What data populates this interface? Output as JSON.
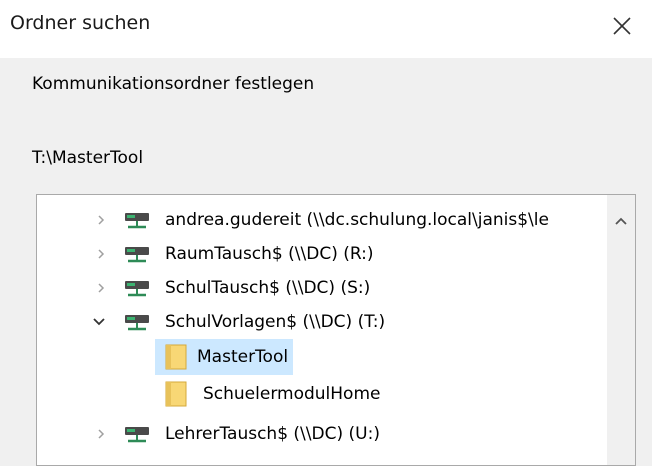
{
  "window": {
    "title": "Ordner suchen",
    "close_icon": "close-icon"
  },
  "description": "Kommunikationsordner festlegen",
  "current_path": "T:\\MasterTool",
  "tree": {
    "items": [
      {
        "label": "andrea.gudereit (\\\\dc.schulung.local\\janis$\\le",
        "icon": "network-drive-icon",
        "expander": "collapsed"
      },
      {
        "label": "RaumTausch$ (\\\\DC) (R:)",
        "icon": "network-drive-icon",
        "expander": "collapsed"
      },
      {
        "label": "SchulTausch$ (\\\\DC) (S:)",
        "icon": "network-drive-icon",
        "expander": "collapsed"
      },
      {
        "label": "SchulVorlagen$ (\\\\DC) (T:)",
        "icon": "network-drive-icon",
        "expander": "expanded"
      },
      {
        "label": "MasterTool",
        "icon": "folder-icon",
        "selected": true
      },
      {
        "label": "SchuelermodulHome",
        "icon": "folder-icon"
      },
      {
        "label": "LehrerTausch$ (\\\\DC) (U:)",
        "icon": "network-drive-icon",
        "expander": "collapsed"
      }
    ]
  },
  "colors": {
    "selection": "#cce8ff",
    "folder": "#f8d775",
    "drive": "#2e8b57"
  }
}
